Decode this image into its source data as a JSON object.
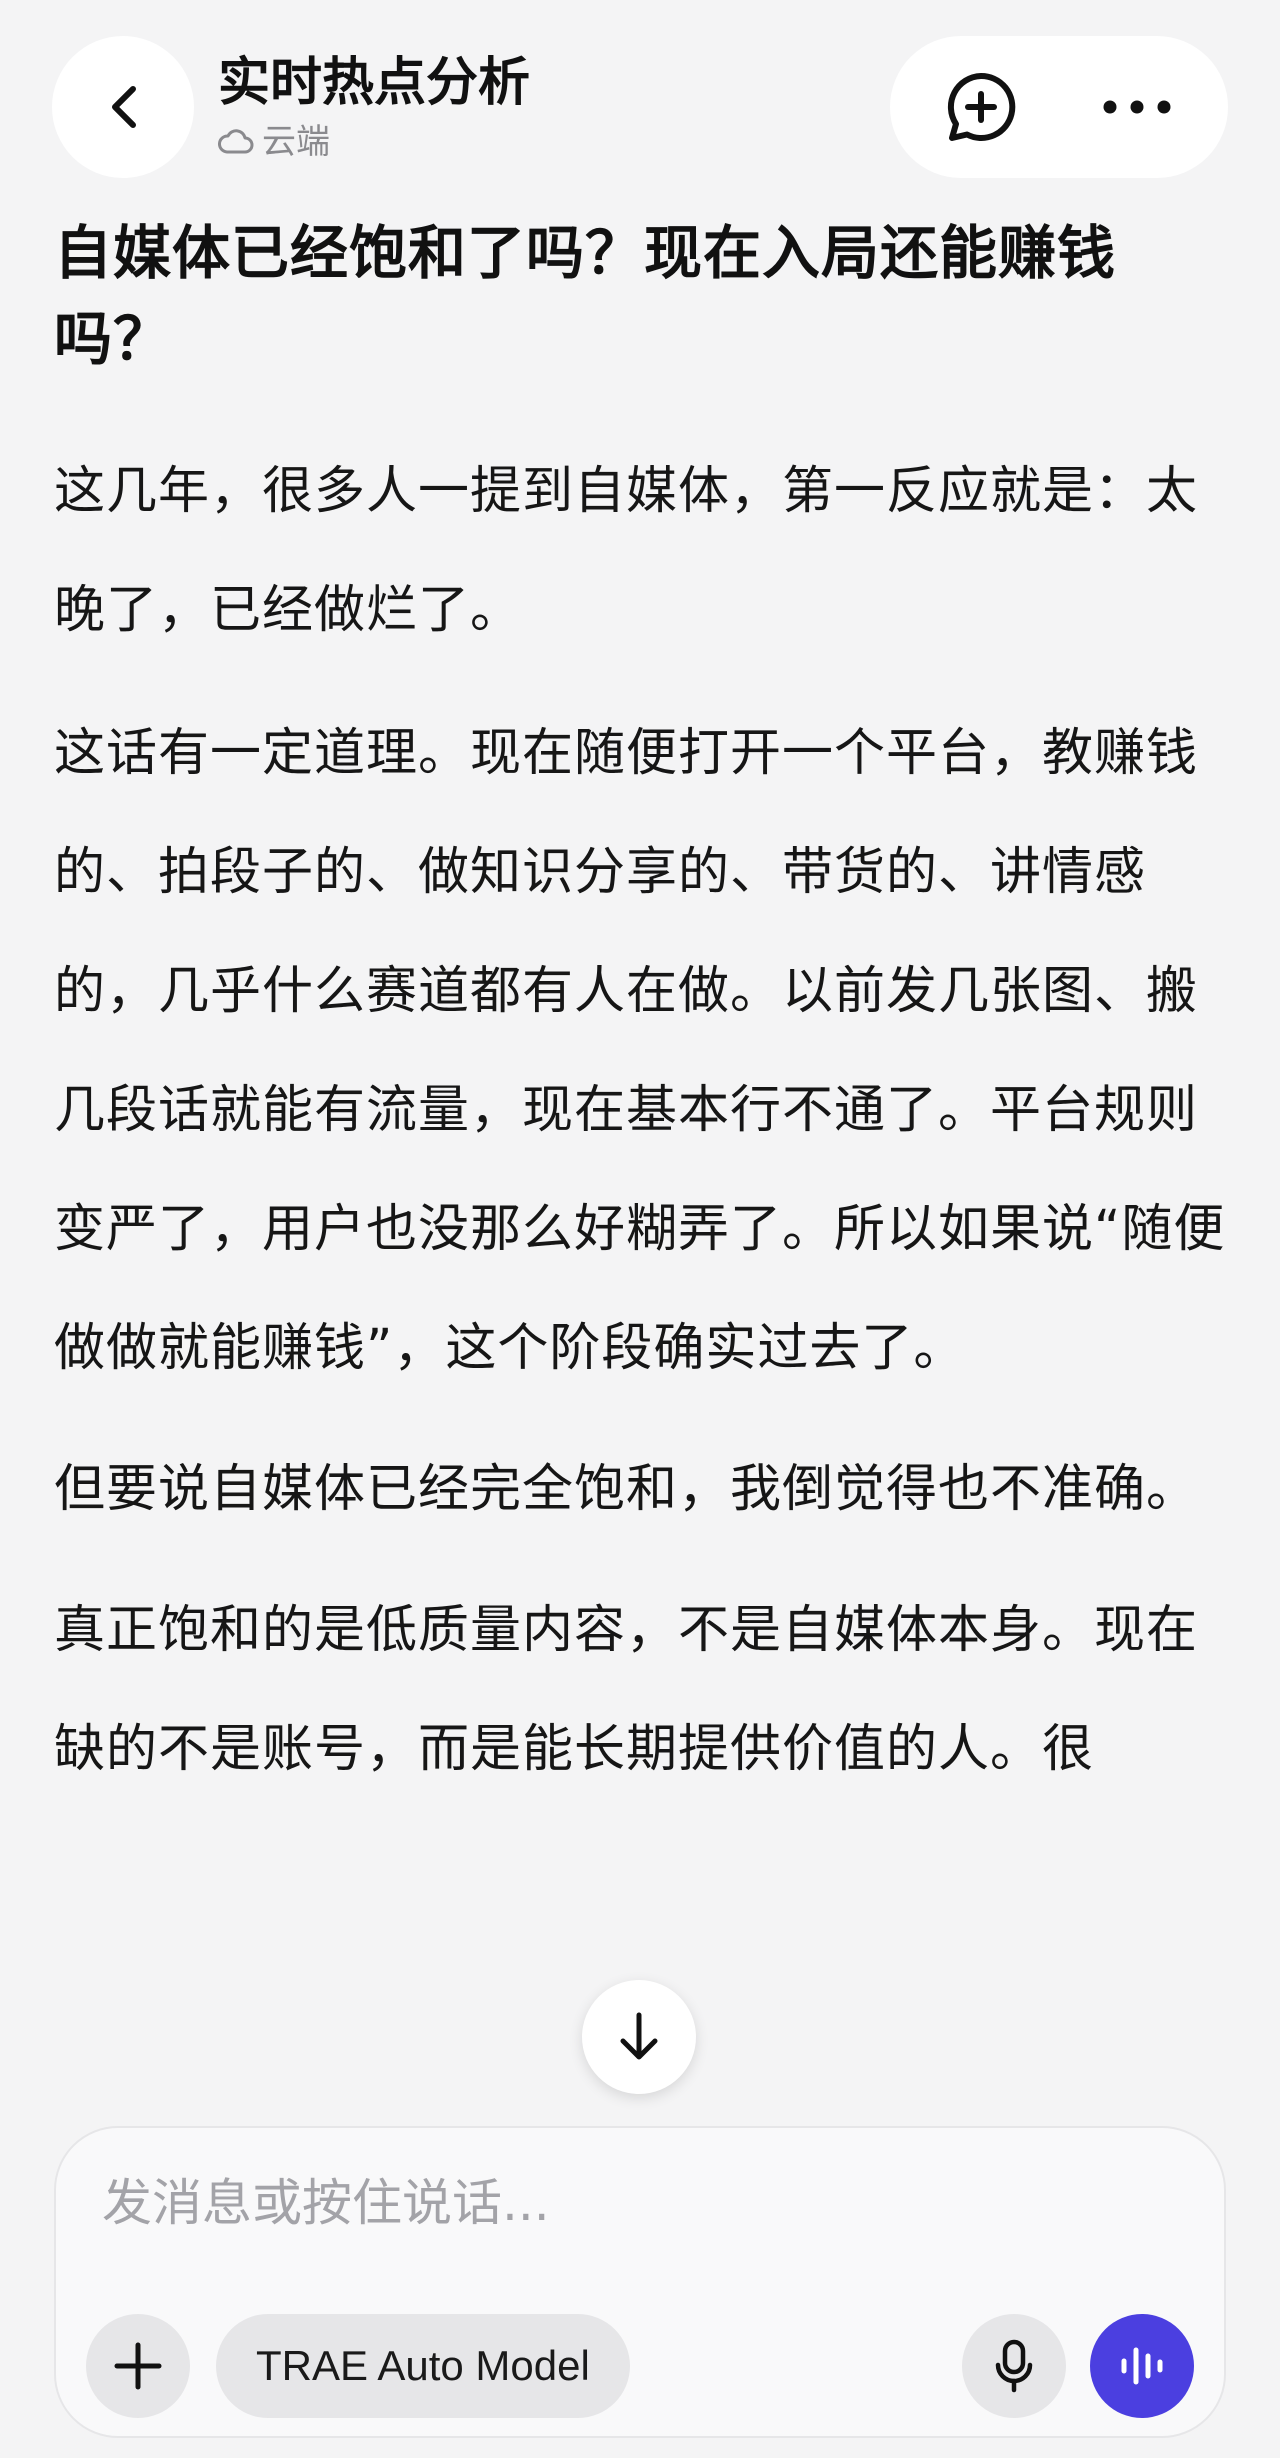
{
  "header": {
    "back_icon": "chevron-left-icon",
    "title": "实时热点分析",
    "storage_icon": "cloud-icon",
    "storage_label": "云端",
    "new_chat_icon": "chat-plus-icon",
    "more_icon": "more-horizontal-icon"
  },
  "article": {
    "title": "自媒体已经饱和了吗？现在入局还能赚钱吗？",
    "paragraphs": [
      "这几年，很多人一提到自媒体，第一反应就是：太晚了，已经做烂了。",
      "这话有一定道理。现在随便打开一个平台，教赚钱的、拍段子的、做知识分享的、带货的、讲情感的，几乎什么赛道都有人在做。以前发几张图、搬几段话就能有流量，现在基本行不通了。平台规则变严了，用户也没那么好糊弄了。所以如果说“随便做做就能赚钱”，这个阶段确实过去了。",
      "但要说自媒体已经完全饱和，我倒觉得也不准确。",
      "真正饱和的是低质量内容，不是自媒体本身。现在缺的不是账号，而是能长期提供价值的人。很"
    ]
  },
  "scroll_down_icon": "arrow-down-icon",
  "composer": {
    "placeholder": "发消息或按住说话...",
    "value": "",
    "add_icon": "plus-icon",
    "model_label": "TRAE Auto Model",
    "mic_icon": "microphone-icon",
    "voice_icon": "voice-wave-icon"
  },
  "colors": {
    "background": "#f4f4f5",
    "surface": "#ffffff",
    "accent": "#4b3fe0",
    "muted_text": "#8a8a8e",
    "placeholder": "#a3a3a8"
  }
}
